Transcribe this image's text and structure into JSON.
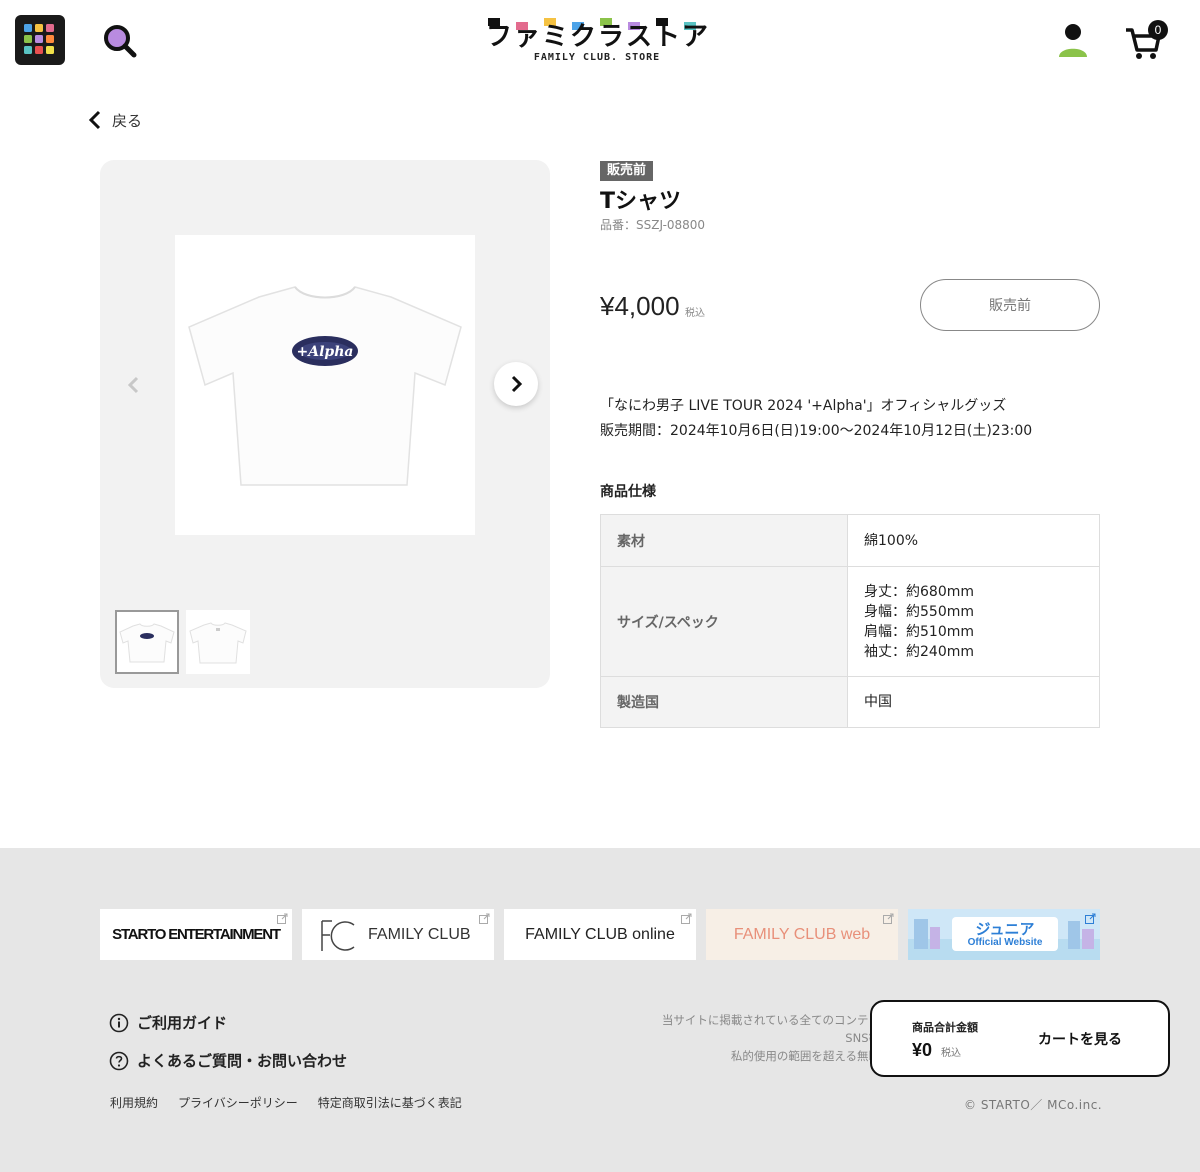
{
  "header": {
    "logo_text": "ファミクラストア",
    "logo_sub": "FAMILY CLUB. STORE",
    "cart_count": "0",
    "menu_colors": [
      "#4da3e8",
      "#f5c242",
      "#e36b8e",
      "#8bc34a",
      "#b98be0",
      "#ff8a3d",
      "#59c3c3",
      "#e85050",
      "#f0e04a"
    ],
    "logo_colors": [
      "#111111",
      "#e36b8e",
      "#f5c242",
      "#4da3e8",
      "#8bc34a",
      "#b98be0",
      "#111111",
      "#59c3c3"
    ]
  },
  "nav": {
    "back_label": "戻る"
  },
  "gallery": {
    "main_image": "tshirt-front-image",
    "thumbnails": [
      "tshirt-front-thumb",
      "tshirt-back-thumb"
    ],
    "print_text": "+Alpha"
  },
  "product": {
    "badge": "販売前",
    "title": "Tシャツ",
    "sku": "品番：SSZJ-08800",
    "price": "¥4,000",
    "tax_label": "税込",
    "status_button": "販売前",
    "description": [
      "「なにわ男子 LIVE TOUR 2024 '+Alpha'」オフィシャルグッズ",
      "販売期間：2024年10月6日(日)19:00〜2024年10月12日(土)23:00"
    ],
    "spec_heading": "商品仕様",
    "specs": [
      {
        "key": "素材",
        "values": [
          "綿100%"
        ]
      },
      {
        "key": "サイズ/スペック",
        "values": [
          "身丈：約680mm",
          "身幅：約550mm",
          "肩幅：約510mm",
          "袖丈：約240mm"
        ]
      },
      {
        "key": "製造国",
        "values": [
          "中国"
        ]
      }
    ]
  },
  "footer": {
    "banners": [
      {
        "label": "STARTO ENTERTAINMENT"
      },
      {
        "label": "FAMILY CLUB"
      },
      {
        "label": "FAMILY CLUB online"
      },
      {
        "label": "FAMILY CLUB web"
      },
      {
        "label": "ジュニア",
        "sub": "Official Website"
      }
    ],
    "guide": "ご利用ガイド",
    "faq": "よくあるご質問・お問い合わせ",
    "links": [
      "利用規約",
      "プライバシーポリシー",
      "特定商取引法に基づく表記"
    ],
    "notice_lines": [
      "当サイトに掲載されている全てのコンテン",
      "SNS等",
      "私的使用の範囲を超える無断"
    ],
    "copyright": "© STARTO／ MCo.inc."
  },
  "cart_panel": {
    "label": "商品合計金額",
    "amount": "¥0",
    "tax_label": "税込",
    "view_cart": "カートを見る"
  }
}
